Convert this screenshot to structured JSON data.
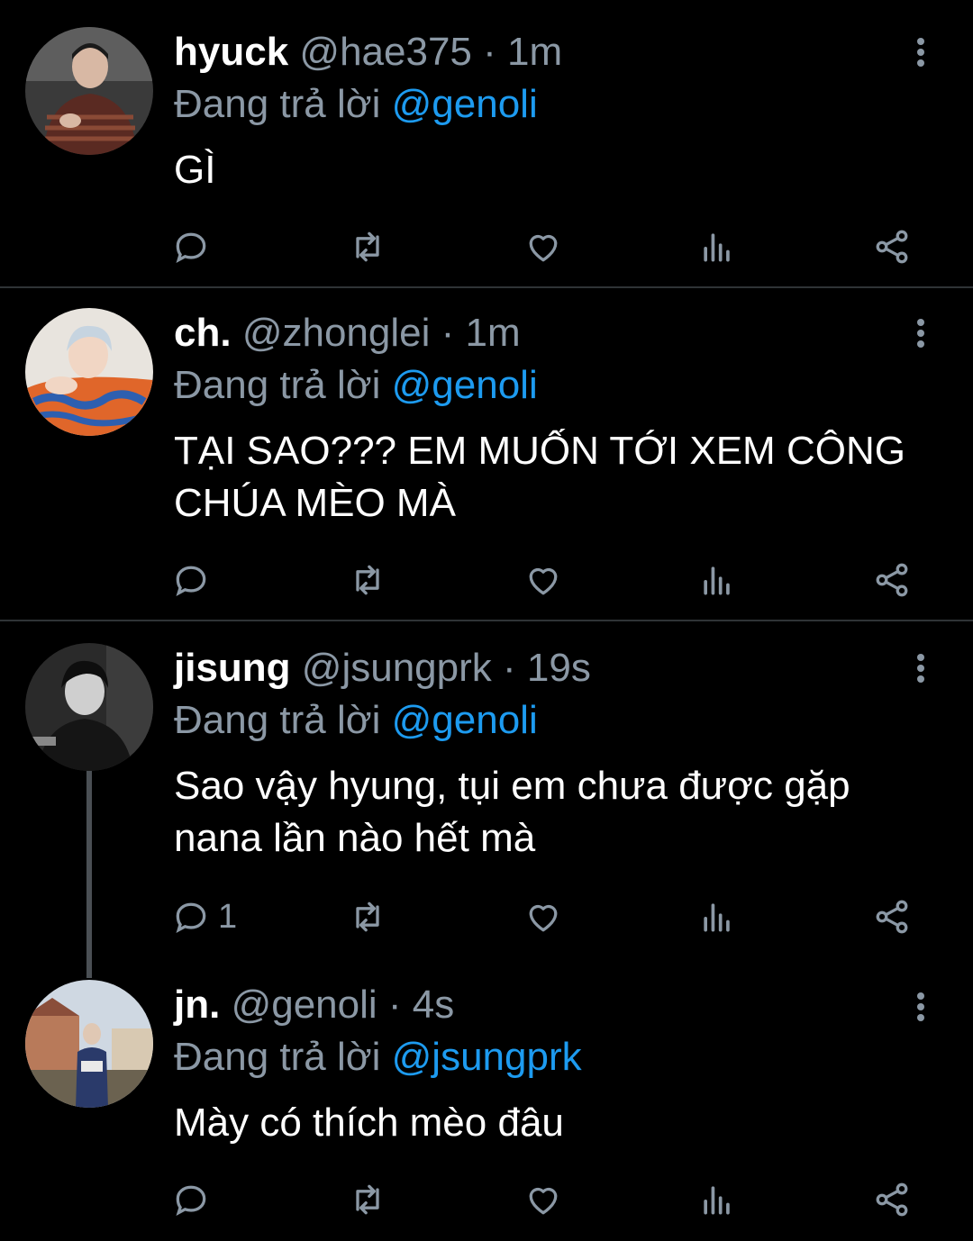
{
  "tweets": [
    {
      "name": "hyuck",
      "handle": "@hae375",
      "separator": "·",
      "time": "1m",
      "reply_prefix": "Đang trả lời",
      "reply_to": "@genoli",
      "text": "GÌ",
      "reply_count": ""
    },
    {
      "name": "ch.",
      "handle": "@zhonglei",
      "separator": "·",
      "time": "1m",
      "reply_prefix": "Đang trả lời",
      "reply_to": "@genoli",
      "text": "TẠI SAO??? EM MUỐN TỚI XEM CÔNG CHÚA MÈO MÀ",
      "reply_count": ""
    },
    {
      "name": "jisung",
      "handle": "@jsungprk",
      "separator": "·",
      "time": "19s",
      "reply_prefix": "Đang trả lời",
      "reply_to": "@genoli",
      "text": "Sao vậy hyung, tụi em chưa được gặp nana lần nào hết mà",
      "reply_count": "1"
    },
    {
      "name": "jn.",
      "handle": "@genoli",
      "separator": "·",
      "time": "4s",
      "reply_prefix": "Đang trả lời",
      "reply_to": "@jsungprk",
      "text": "Mày có thích mèo đâu",
      "reply_count": ""
    }
  ],
  "icons": {
    "reply": "reply-icon",
    "retweet": "retweet-icon",
    "like": "heart-icon",
    "analytics": "analytics-icon",
    "share": "share-icon",
    "more": "more-vertical-icon"
  },
  "colors": {
    "background": "#000000",
    "primary_text": "#ffffff",
    "secondary_text": "#8b98a5",
    "mention": "#1d9bf0",
    "divider": "#2f3336",
    "thread_line": "#4a4f54"
  }
}
